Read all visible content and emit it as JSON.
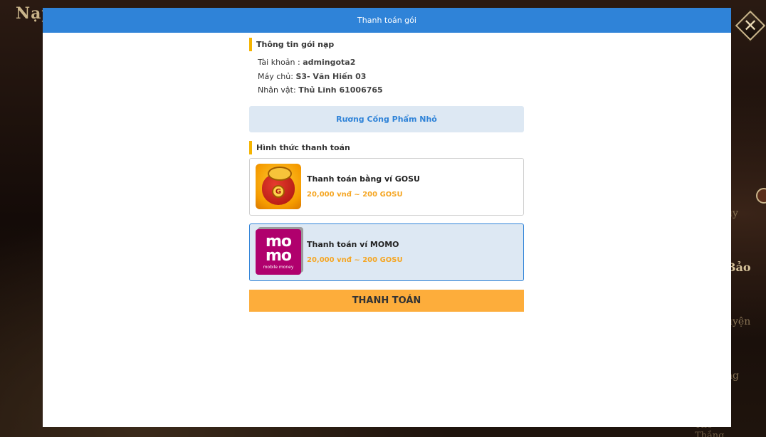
{
  "background": {
    "title": "Nạp",
    "side_labels": [
      "",
      "uy",
      "Bảo",
      "uyện",
      "ng",
      "The Thắng"
    ]
  },
  "modal": {
    "title": "Thanh toán gói",
    "close_label": "✕"
  },
  "package_info": {
    "section_title": "Thông tin gói nạp",
    "account_label": "Tài khoản : ",
    "account_value": "admingota2",
    "server_label": "Máy chủ: ",
    "server_value": "S3- Văn Hiến 03",
    "character_label": "Nhân vật: ",
    "character_value": "Thủ Lĩnh 61006765"
  },
  "package_name": "Rương Cống Phẩm Nhỏ",
  "payment": {
    "section_title": "Hình thức thanh toán",
    "options": [
      {
        "name": "Thanh toán bằng ví GOSU",
        "price": "20,000 vnđ ~ 200 GOSU",
        "icon": "gosu-wallet-icon",
        "logo_text": "G",
        "selected": false
      },
      {
        "name": "Thanh toán ví MOMO",
        "price": "20,000 vnđ ~ 200 GOSU",
        "icon": "momo-wallet-icon",
        "logo_line1": "mo",
        "logo_line2": "mo",
        "logo_sub": "mobile money",
        "selected": true
      }
    ]
  },
  "submit_label": "THANH TOÁN",
  "colors": {
    "header": "#2f83d8",
    "accent": "#f5b400",
    "price": "#f5a623",
    "button": "#fdad3b",
    "selected_bg": "#dde8f3"
  }
}
